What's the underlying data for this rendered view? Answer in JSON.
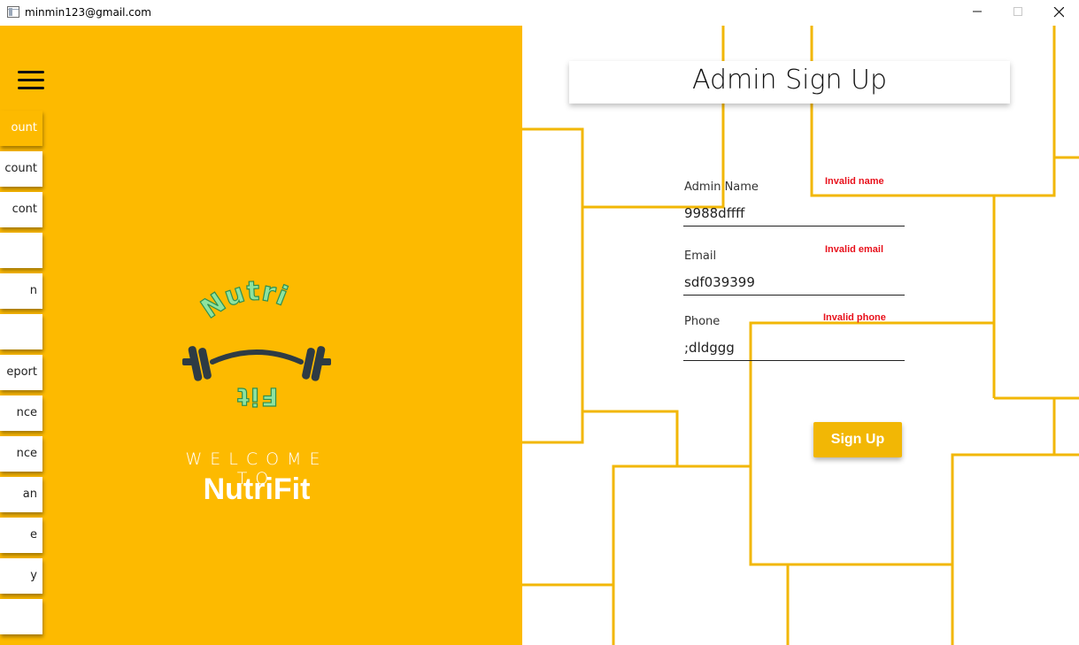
{
  "window": {
    "title": "minmin123@gmail.com"
  },
  "sidebar": {
    "items": [
      {
        "label": "ount",
        "active": true
      },
      {
        "label": "count",
        "active": false
      },
      {
        "label": "cont",
        "active": false
      },
      {
        "label": "",
        "active": false
      },
      {
        "label": "n",
        "active": false
      },
      {
        "label": "",
        "active": false
      },
      {
        "label": "eport",
        "active": false
      },
      {
        "label": "nce",
        "active": false
      },
      {
        "label": "nce",
        "active": false
      },
      {
        "label": "an",
        "active": false
      },
      {
        "label": "e",
        "active": false
      },
      {
        "label": "y",
        "active": false
      },
      {
        "label": "",
        "active": false
      }
    ]
  },
  "brand": {
    "logo_top_text": "Nutri",
    "logo_bottom_text": "Fit",
    "welcome": "WELCOME TO",
    "name": "NutriFit"
  },
  "form": {
    "title": "Admin Sign Up",
    "name_label": "Admin Name",
    "name_value": "9988dffff",
    "name_error": "Invalid name",
    "email_label": "Email",
    "email_value": "sdf039399",
    "email_error": "Invalid email",
    "phone_label": "Phone",
    "phone_value": ";dldggg",
    "phone_error": "Invalid phone",
    "submit_label": "Sign Up"
  },
  "colors": {
    "accent": "#fdba00",
    "button": "#f2b705",
    "error": "#e8111c",
    "lines": "#f2b705"
  }
}
